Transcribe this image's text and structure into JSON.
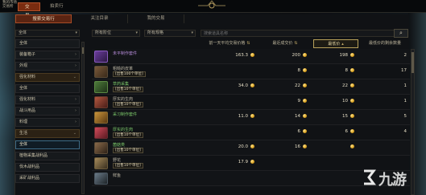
{
  "window": {
    "corner_label_line1": "我的市场",
    "corner_label_line2": "交易所"
  },
  "main_tabs": [
    {
      "label": "交易行",
      "active": true
    },
    {
      "label": "拍卖行",
      "active": false
    }
  ],
  "sub_tabs": [
    {
      "label": "搜索交易行",
      "active": true
    },
    {
      "label": "关注目录",
      "active": false
    },
    {
      "label": "我的交易",
      "active": false
    }
  ],
  "filters": {
    "region": "全体",
    "slot": "所有阶位",
    "grade": "所有规格",
    "search_placeholder": "搜索道具名称"
  },
  "sidebar": {
    "items": [
      {
        "label": "全体",
        "type": "normal"
      },
      {
        "label": "装备箱子",
        "type": "normal"
      },
      {
        "label": "外观",
        "type": "normal"
      },
      {
        "label": "强化材料",
        "type": "head"
      },
      {
        "label": "全体",
        "type": "normal"
      },
      {
        "label": "强化材料",
        "type": "normal"
      },
      {
        "label": "战斗用品",
        "type": "normal"
      },
      {
        "label": "料理",
        "type": "normal"
      },
      {
        "label": "生活",
        "type": "head"
      },
      {
        "label": "全体",
        "type": "selected"
      },
      {
        "label": "植物采集战利品",
        "type": "normal"
      },
      {
        "label": "伐木战利品",
        "type": "normal"
      },
      {
        "label": "采矿战利品",
        "type": "normal"
      }
    ]
  },
  "table": {
    "headers": {
      "name": "",
      "avg_price": "前一天平均交易价格",
      "recent_price": "最近成交价",
      "min_price": "最低价",
      "min_count": "最低价的剩余数量"
    },
    "rows": [
      {
        "name": "未平制作套件",
        "sub": "",
        "color": "purple",
        "icon": "purple-chest-icon",
        "avg": "163.3",
        "recent": "200",
        "min": "198",
        "count": "2"
      },
      {
        "name": "粗糙的皮革",
        "sub": "[出售100个单位]",
        "color": "gray",
        "icon": "leather-icon",
        "avg": "",
        "recent": "",
        "min": "",
        "count": ""
      },
      {
        "name": "草药采集",
        "sub": "[出售10个单位]",
        "color": "green",
        "icon": "herb-icon",
        "avg": "34.0",
        "recent": "22",
        "min": "22",
        "count": "1"
      },
      {
        "name": "厚实的生肉",
        "sub": "[出售10个单位]",
        "color": "gray",
        "icon": "meat-icon",
        "avg": "",
        "recent": "",
        "min": "",
        "count": ""
      },
      {
        "name": "采习制作套件",
        "sub": "",
        "color": "green",
        "icon": "gold-chest-icon",
        "avg": "11.0",
        "recent": "14",
        "min": "15",
        "count": "5"
      },
      {
        "name": "厚实的生肉",
        "sub": "[出售10个单位]",
        "color": "green",
        "icon": "red-meat-icon",
        "avg": "",
        "recent": "",
        "min": "",
        "count": ""
      },
      {
        "name": "菌菇类",
        "sub": "[出售10个单位]",
        "color": "green",
        "icon": "mushroom-icon",
        "avg": "20.0",
        "recent": "",
        "min": "",
        "count": ""
      },
      {
        "name": "野花",
        "sub": "[出售10个单位]",
        "color": "gray",
        "icon": "flower-icon",
        "avg": "17.9",
        "recent": "",
        "min": "",
        "count": ""
      },
      {
        "name": "鲜鱼",
        "sub": "",
        "color": "gray",
        "icon": "fish-icon",
        "avg": "",
        "recent": "",
        "min": "",
        "count": ""
      }
    ],
    "extra_rows": [
      {
        "recent": "8",
        "min": "8",
        "count": "17"
      },
      {
        "recent": "9",
        "min": "10",
        "count": "1"
      },
      {
        "recent": "6",
        "min": "6",
        "count": "4"
      },
      {
        "recent": "16",
        "min": "",
        "count": ""
      },
      {
        "recent": "",
        "min": "",
        "count": ""
      }
    ]
  },
  "watermark": {
    "text": "九游"
  },
  "colors": {
    "accent": "#7a2c10",
    "sorted_border": "#b8a15a",
    "purple_name": "#b48ad6",
    "green_name": "#7cc86a"
  }
}
